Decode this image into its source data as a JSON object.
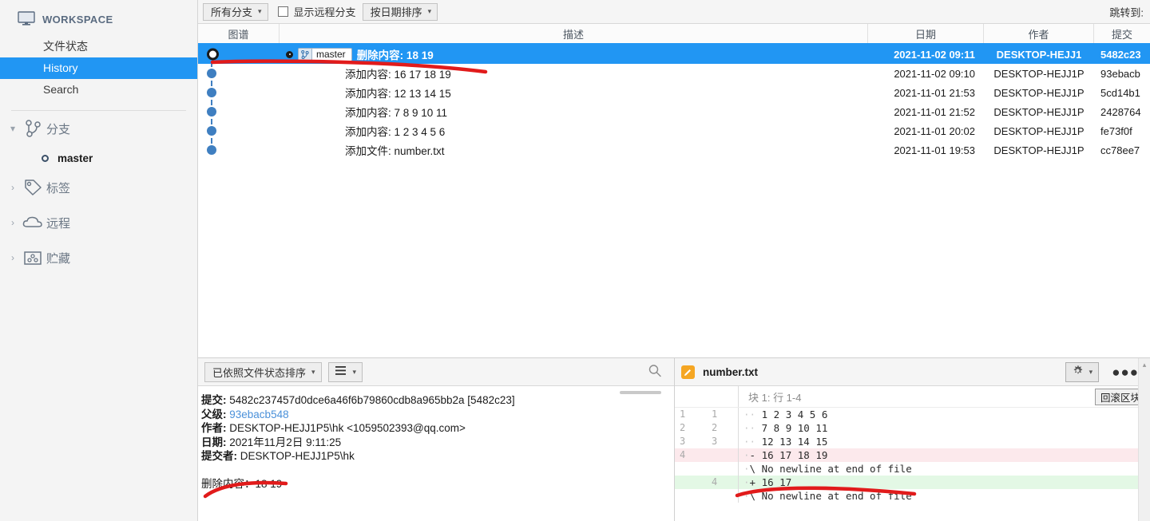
{
  "sidebar": {
    "workspace_label": "WORKSPACE",
    "workspace_icon": "monitor-icon",
    "nav": [
      {
        "label": "文件状态",
        "selected": false
      },
      {
        "label": "History",
        "selected": true
      },
      {
        "label": "Search",
        "selected": false
      }
    ],
    "tree": [
      {
        "label": "分支",
        "icon": "branch-icon",
        "expanded": true,
        "twisty": "▾"
      },
      {
        "label": "标签",
        "icon": "tag-icon",
        "expanded": false,
        "twisty": "›"
      },
      {
        "label": "远程",
        "icon": "cloud-icon",
        "expanded": false,
        "twisty": "›"
      },
      {
        "label": "贮藏",
        "icon": "stash-icon",
        "expanded": false,
        "twisty": "›"
      }
    ],
    "branch": {
      "name": "master",
      "icon": "branch-node-icon"
    }
  },
  "toolbar": {
    "branch_filter": "所有分支",
    "show_remote_label": "显示远程分支",
    "show_remote_checked": false,
    "sort_order": "按日期排序",
    "jump_to_label": "跳转到:"
  },
  "commit_table": {
    "columns": [
      "图谱",
      "描述",
      "日期",
      "作者",
      "提交"
    ],
    "rows": [
      {
        "ref": "master",
        "message": "删除内容: 18 19",
        "date": "2021-11-02 09:11",
        "author": "DESKTOP-HEJJ1",
        "commit": "5482c23",
        "selected": true
      },
      {
        "ref": "",
        "message": "添加内容: 16 17 18 19",
        "date": "2021-11-02 09:10",
        "author": "DESKTOP-HEJJ1P",
        "commit": "93ebacb",
        "selected": false
      },
      {
        "ref": "",
        "message": "添加内容: 12 13 14 15",
        "date": "2021-11-01 21:53",
        "author": "DESKTOP-HEJJ1P",
        "commit": "5cd14b1",
        "selected": false
      },
      {
        "ref": "",
        "message": "添加内容: 7 8 9 10 11",
        "date": "2021-11-01 21:52",
        "author": "DESKTOP-HEJJ1P",
        "commit": "2428764",
        "selected": false
      },
      {
        "ref": "",
        "message": "添加内容: 1 2 3 4 5 6",
        "date": "2021-11-01 20:02",
        "author": "DESKTOP-HEJJ1P",
        "commit": "fe73f0f",
        "selected": false
      },
      {
        "ref": "",
        "message": "添加文件: number.txt",
        "date": "2021-11-01 19:53",
        "author": "DESKTOP-HEJJ1P",
        "commit": "cc78ee7",
        "selected": false
      }
    ]
  },
  "detail_panel": {
    "sort_combo": "已依照文件状态排序",
    "view_combo_icon": "list-view-icon",
    "search_icon": "search-icon",
    "fields": [
      {
        "label": "提交:",
        "value": "5482c237457d0dce6a46f6b79860cdb8a965bb2a [5482c23]",
        "link": false
      },
      {
        "label": "父级:",
        "value": "93ebacb548",
        "link": true
      },
      {
        "label": "作者:",
        "value": "DESKTOP-HEJJ1P5\\hk <1059502393@qq.com>",
        "link": false
      },
      {
        "label": "日期:",
        "value": "2021年11月2日 9:11:25",
        "link": false
      },
      {
        "label": "提交者:",
        "value": "DESKTOP-HEJJ1P5\\hk",
        "link": false
      }
    ],
    "commit_message": "删除内容：18 19"
  },
  "diff_panel": {
    "file_name": "number.txt",
    "file_icon": "edited-file-icon",
    "gear_icon": "gear-icon",
    "more_icon": "more-options-icon",
    "hunk_label": "块 1: 行 1-4",
    "rollback_button": "回滚区块",
    "lines": [
      {
        "old": "1",
        "new": "1",
        "marker": "",
        "text": "1 2 3 4 5 6",
        "type": "ctx"
      },
      {
        "old": "2",
        "new": "2",
        "marker": "",
        "text": "7 8 9 10 11",
        "type": "ctx"
      },
      {
        "old": "3",
        "new": "3",
        "marker": "",
        "text": "12 13 14 15",
        "type": "ctx"
      },
      {
        "old": "4",
        "new": "",
        "marker": "-",
        "text": "16 17 18 19",
        "type": "del"
      },
      {
        "old": "",
        "new": "",
        "marker": "\\",
        "text": "No newline at end of file",
        "type": "meta"
      },
      {
        "old": "",
        "new": "4",
        "marker": "+",
        "text": "16 17",
        "type": "add"
      },
      {
        "old": "",
        "new": "",
        "marker": "\\",
        "text": "No newline at end of file",
        "type": "meta"
      }
    ]
  },
  "colors": {
    "accent": "#2196f3",
    "annotation": "#e11b1b",
    "diff_add_bg": "#e3f8e5",
    "diff_del_bg": "#fce9ec",
    "file_icon_bg": "#f5a623"
  }
}
